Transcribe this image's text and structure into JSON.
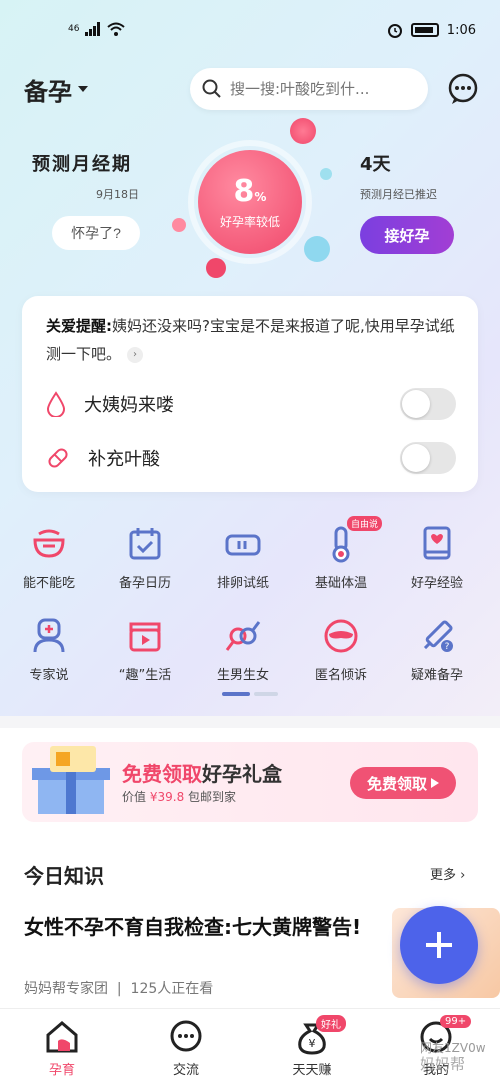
{
  "status_bar": {
    "network": "46",
    "time": "1:06"
  },
  "header": {
    "mode": "备孕",
    "search_placeholder": "搜一搜:叶酸吃到什..."
  },
  "prediction": {
    "title": "预测月经期",
    "date": "9月18日",
    "pregnant_button": "怀孕了?",
    "rate_value": "8",
    "rate_unit": "%",
    "rate_label": "好孕率较低",
    "delay_days": "4天",
    "delay_note": "预测月经已推迟",
    "good_button": "接好孕"
  },
  "reminder_card": {
    "label": "关爱提醒:",
    "text": "姨妈还没来吗?宝宝是不是来报道了呢,快用早孕试纸测一下吧。",
    "toggles": [
      {
        "label": "大姨妈来喽",
        "on": false
      },
      {
        "label": "补充叶酸",
        "on": false
      }
    ]
  },
  "tools": [
    {
      "label": "能不能吃",
      "icon": "bowl-icon"
    },
    {
      "label": "备孕日历",
      "icon": "calendar-icon"
    },
    {
      "label": "排卵试纸",
      "icon": "test-strip-icon"
    },
    {
      "label": "基础体温",
      "icon": "thermometer-icon",
      "badge": "自由说"
    },
    {
      "label": "好孕经验",
      "icon": "book-icon"
    },
    {
      "label": "专家说",
      "icon": "doctor-icon"
    },
    {
      "label": "“趣”生活",
      "icon": "clapper-icon"
    },
    {
      "label": "生男生女",
      "icon": "gender-icon"
    },
    {
      "label": "匿名倾诉",
      "icon": "mask-icon"
    },
    {
      "label": "疑难备孕",
      "icon": "syringe-icon"
    }
  ],
  "banner": {
    "title_pink": "免费领取",
    "title_dark": "好孕礼盒",
    "sub_prefix": "价值",
    "price": "¥39.8",
    "sub_suffix": "包邮到家",
    "button": "免费领取"
  },
  "knowledge": {
    "title": "今日知识",
    "more": "更多",
    "article_title": "女性不孕不育自我检查:七大黄牌警告!",
    "author": "妈妈帮专家团",
    "viewers": "125人正在看"
  },
  "bottom_nav": [
    {
      "label": "孕育",
      "active": true
    },
    {
      "label": "交流"
    },
    {
      "label": "天天赚",
      "badge": "好礼"
    },
    {
      "label": "我的",
      "badge": "99+"
    }
  ],
  "watermark": [
    "网友1ZV0w",
    "妈妈帮"
  ],
  "colors": {
    "accent_pink": "#f0476a",
    "accent_purple": "#7b3fe0",
    "fab_blue": "#4d63ea"
  }
}
